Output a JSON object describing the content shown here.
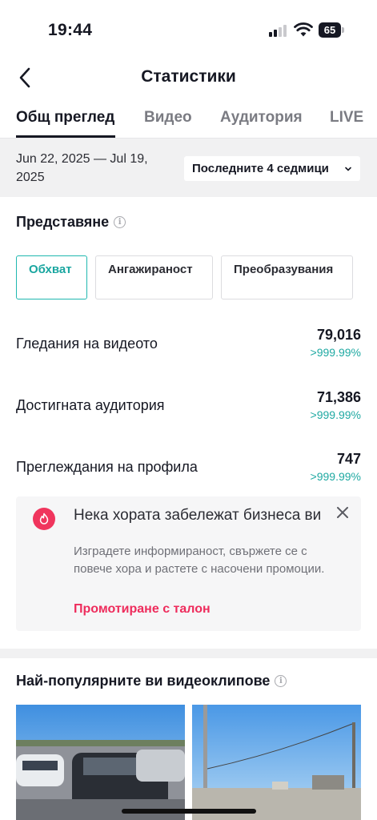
{
  "status_bar": {
    "time": "19:44",
    "battery_level": "65"
  },
  "header": {
    "title": "Статистики"
  },
  "tabs": [
    {
      "label": "Общ преглед",
      "active": true
    },
    {
      "label": "Видео",
      "active": false
    },
    {
      "label": "Аудитория",
      "active": false
    },
    {
      "label": "LIVE",
      "active": false
    }
  ],
  "date_filter": {
    "range": "Jun 22, 2025 — Jul 19, 2025",
    "period": "Последните 4 седмици"
  },
  "performance": {
    "title": "Представяне",
    "metric_tabs": [
      {
        "label": "Обхват",
        "active": true
      },
      {
        "label": "Ангажираност",
        "active": false
      },
      {
        "label": "Преобразувания",
        "active": false
      }
    ],
    "stats": [
      {
        "label": "Гледания на видеото",
        "value": "79,016",
        "change": ">999.99%"
      },
      {
        "label": "Достигната аудитория",
        "value": "71,386",
        "change": ">999.99%"
      },
      {
        "label": "Преглеждания на профила",
        "value": "747",
        "change": ">999.99%"
      }
    ]
  },
  "promo": {
    "title": "Нека хората забележат бизнеса ви",
    "text": "Изградете информираност, свържете се с повече хора и растете с насочени промоции.",
    "link": "Промотиране с талон"
  },
  "top_videos": {
    "title": "Най-популярните ви видеоклипове"
  },
  "colors": {
    "accent_teal": "#1fa9a2",
    "brand_pink": "#ee2c5c",
    "promo_icon_red": "#f0355d"
  }
}
